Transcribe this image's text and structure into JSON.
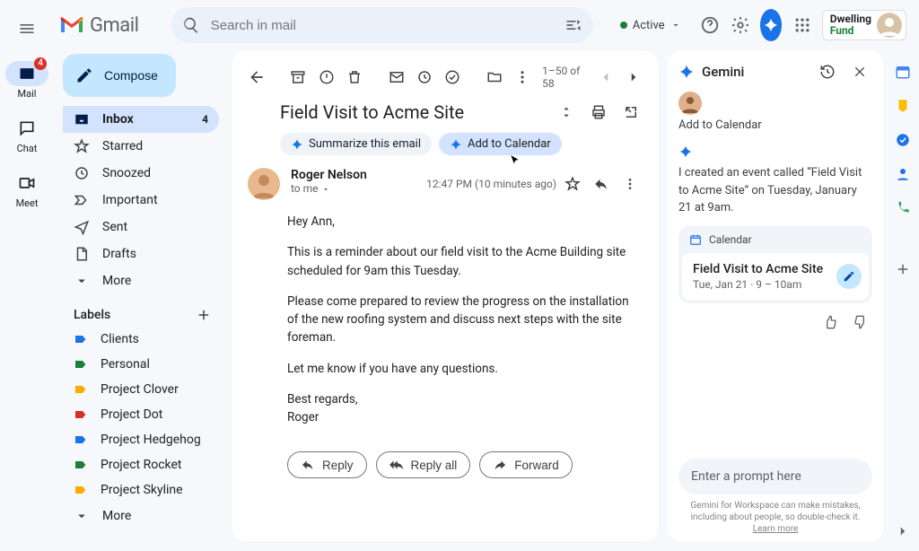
{
  "header": {
    "product": "Gmail",
    "search_placeholder": "Search in mail",
    "status": "Active",
    "brand_line1": "Dwelling",
    "brand_line2": "Fund"
  },
  "app_rail": {
    "items": [
      {
        "label": "Mail",
        "badge": "4"
      },
      {
        "label": "Chat"
      },
      {
        "label": "Meet"
      }
    ]
  },
  "sidebar": {
    "compose": "Compose",
    "nav": [
      {
        "label": "Inbox",
        "count": "4"
      },
      {
        "label": "Starred"
      },
      {
        "label": "Snoozed"
      },
      {
        "label": "Important"
      },
      {
        "label": "Sent"
      },
      {
        "label": "Drafts"
      },
      {
        "label": "More"
      }
    ],
    "labels_header": "Labels",
    "labels": [
      {
        "label": "Clients",
        "color": "#1a73e8"
      },
      {
        "label": "Personal",
        "color": "#188038"
      },
      {
        "label": "Project Clover",
        "color": "#f9ab00"
      },
      {
        "label": "Project Dot",
        "color": "#d93025"
      },
      {
        "label": "Project Hedgehog",
        "color": "#1a73e8"
      },
      {
        "label": "Project Rocket",
        "color": "#188038"
      },
      {
        "label": "Project Skyline",
        "color": "#f9ab00"
      }
    ],
    "labels_more": "More"
  },
  "toolbar": {
    "page_info": "1–50 of 58"
  },
  "chips": {
    "summarize": "Summarize this email",
    "add_cal": "Add to Calendar"
  },
  "email": {
    "subject": "Field Visit to Acme Site",
    "sender": "Roger Nelson",
    "to": "to me",
    "timestamp": "12:47 PM (10 minutes ago)",
    "p1": "Hey Ann,",
    "p2": "This is a reminder about our field visit to the Acme Building site scheduled for 9am this Tuesday.",
    "p3": "Please come prepared to review the progress on the installation of the new roofing system and discuss next steps with the site foreman.",
    "p4": "Let me know if you have any questions.",
    "p5": "Best regards,",
    "p6": "Roger",
    "reply": "Reply",
    "reply_all": "Reply all",
    "forward": "Forward"
  },
  "gemini": {
    "title": "Gemini",
    "user_prompt": "Add to Calendar",
    "response": "I created an event called “Field Visit to Acme Site” on Tuesday, January 21 at 9am.",
    "event_source": "Calendar",
    "event_title": "Field Visit to Acme Site",
    "event_time": "Tue, Jan 21 · 9 – 10am",
    "prompt_placeholder": "Enter a prompt here",
    "disclaimer_a": "Gemini for Workspace can make mistakes, including about people, so double-check it. ",
    "disclaimer_link": "Learn more"
  }
}
